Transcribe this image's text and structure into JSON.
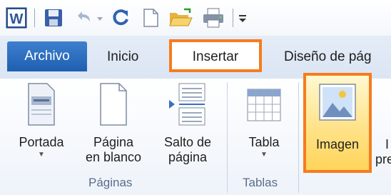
{
  "qat": {
    "icons": [
      "word-icon",
      "save-icon",
      "undo-icon",
      "redo-icon",
      "new-document-icon",
      "open-folder-icon",
      "print-icon",
      "customize-icon"
    ]
  },
  "tabs": {
    "file": "Archivo",
    "home": "Inicio",
    "insert": "Insertar",
    "design": "Diseño de pág"
  },
  "ribbon": {
    "pages_group": {
      "cover": {
        "label_line1": "Portada",
        "label_line2": ""
      },
      "blank": {
        "label_line1": "Página",
        "label_line2": "en blanco"
      },
      "break": {
        "label_line1": "Salto de",
        "label_line2": "página"
      },
      "group_label": "Páginas"
    },
    "tables_group": {
      "table": {
        "label": "Tabla"
      },
      "group_label": "Tablas"
    },
    "image": {
      "label": "Imagen"
    },
    "partial_next": {
      "line1": "I",
      "line2": "pre"
    }
  },
  "colors": {
    "highlight": "#f57c1f",
    "file_tab": "#2a6bbf"
  }
}
